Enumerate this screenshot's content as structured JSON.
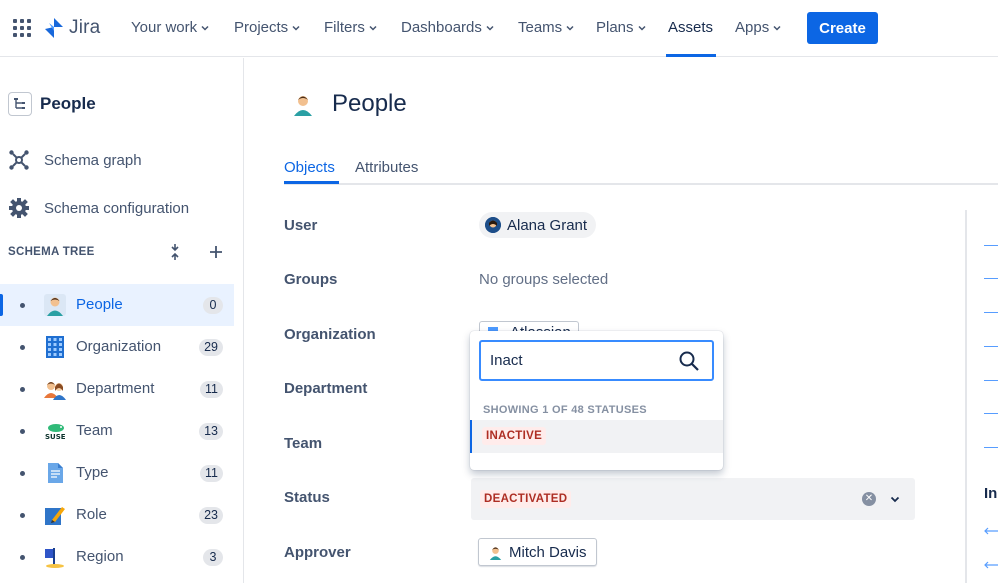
{
  "topnav": {
    "product": "Jira",
    "items": [
      {
        "label": "Your work",
        "dropdown": true
      },
      {
        "label": "Projects",
        "dropdown": true
      },
      {
        "label": "Filters",
        "dropdown": true
      },
      {
        "label": "Dashboards",
        "dropdown": true
      },
      {
        "label": "Teams",
        "dropdown": true
      },
      {
        "label": "Plans",
        "dropdown": true
      },
      {
        "label": "Assets",
        "dropdown": false,
        "active": true
      },
      {
        "label": "Apps",
        "dropdown": true
      }
    ],
    "create_label": "Create"
  },
  "sidebar": {
    "title": "People",
    "links": [
      {
        "label": "Schema graph",
        "icon": "schema-graph-icon"
      },
      {
        "label": "Schema configuration",
        "icon": "gear-icon"
      }
    ],
    "tree_heading": "SCHEMA TREE",
    "tree": [
      {
        "label": "People",
        "count": "0",
        "icon": "person-icon",
        "selected": true
      },
      {
        "label": "Organization",
        "count": "29",
        "icon": "building-icon"
      },
      {
        "label": "Department",
        "count": "11",
        "icon": "group-icon"
      },
      {
        "label": "Team",
        "count": "13",
        "icon": "suse-icon"
      },
      {
        "label": "Type",
        "count": "11",
        "icon": "document-icon"
      },
      {
        "label": "Role",
        "count": "23",
        "icon": "pencil-icon"
      },
      {
        "label": "Region",
        "count": "3",
        "icon": "flag-icon"
      }
    ]
  },
  "main": {
    "title": "People",
    "tabs": [
      {
        "label": "Objects",
        "active": true
      },
      {
        "label": "Attributes",
        "active": false
      }
    ],
    "fields": {
      "user_label": "User",
      "user_value": "Alana Grant",
      "groups_label": "Groups",
      "groups_value": "No groups selected",
      "organization_label": "Organization",
      "organization_value_fragment": "Atlassian",
      "department_label": "Department",
      "team_label": "Team",
      "status_label": "Status",
      "status_value": "DEACTIVATED",
      "approver_label": "Approver",
      "approver_value": "Mitch Davis"
    }
  },
  "dropdown": {
    "search_value": "Inact",
    "meta": "SHOWING 1 OF 48 STATUSES",
    "options": [
      "INACTIVE"
    ]
  },
  "right_panel": {
    "partial_heading": "In"
  },
  "colors": {
    "brand_blue": "#0c66e4",
    "lozenge_red_bg": "#ffeceb",
    "lozenge_red_text": "#ae2e24"
  }
}
